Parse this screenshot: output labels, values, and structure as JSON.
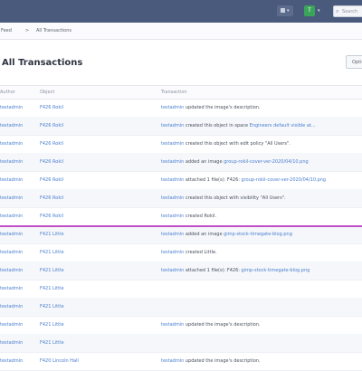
{
  "topbar": {
    "avatar_letter": "T",
    "search_placeholder": "Search",
    "bg": "#4a5a7c"
  },
  "breadcrumb": {
    "items": [
      "Feed",
      "All Transactions"
    ],
    "separator": ">"
  },
  "header": {
    "title": "All Transactions",
    "button_label": "Options"
  },
  "table": {
    "columns": [
      "Author",
      "Object",
      "Transaction"
    ],
    "rows": [
      {
        "author": "testadmin",
        "object": "F426 Rokil",
        "actor": "testadmin",
        "text": " updated the image's description."
      },
      {
        "author": "testadmin",
        "object": "F426 Rokil",
        "actor": "testadmin",
        "text": " created this object in space ",
        "link": "Engineers default visible at..."
      },
      {
        "author": "testadmin",
        "object": "F426 Rokil",
        "actor": "testadmin",
        "text": " created this object with edit policy \"All Users\"."
      },
      {
        "author": "testadmin",
        "object": "F426 Rokil",
        "actor": "testadmin",
        "text": " added an image ",
        "link": "group-rokil-cover-ver-2020/04/10.png"
      },
      {
        "author": "testadmin",
        "object": "F426 Rokil",
        "actor": "testadmin",
        "text": " attached 1 file(s): F426: ",
        "link": "group-rokil-cover-ver-2020/04/10.png"
      },
      {
        "author": "testadmin",
        "object": "F426 Rokil",
        "actor": "testadmin",
        "text": " created this object with visibility \"All Users\"."
      },
      {
        "author": "testadmin",
        "object": "F426 Rokil",
        "actor": "testadmin",
        "text": " created Rokil."
      },
      {
        "author": "testadmin",
        "object": "F421 Little",
        "actor": "testadmin",
        "text": " added an image ",
        "link": "gimp-stock-timegate-blog.png"
      },
      {
        "author": "testadmin",
        "object": "F421 Little",
        "actor": "testadmin",
        "text": " created Little."
      },
      {
        "author": "testadmin",
        "object": "F421 Little",
        "actor": "testadmin",
        "text": " attached 1 file(s): F426: ",
        "link": "gimp-stock-timegate-blog.png"
      },
      {
        "author": "testadmin",
        "object": "F421 Little",
        "actor": "",
        "text": ""
      },
      {
        "author": "testadmin",
        "object": "F421 Little",
        "actor": "",
        "text": ""
      },
      {
        "author": "testadmin",
        "object": "F421 Little",
        "actor": "testadmin",
        "text": " updated the image's description."
      },
      {
        "author": "testadmin",
        "object": "F421 Little",
        "actor": "",
        "text": ""
      },
      {
        "author": "testadmin",
        "object": "F420 Lincoln Hall",
        "actor": "testadmin",
        "text": " updated the image's description."
      }
    ]
  }
}
